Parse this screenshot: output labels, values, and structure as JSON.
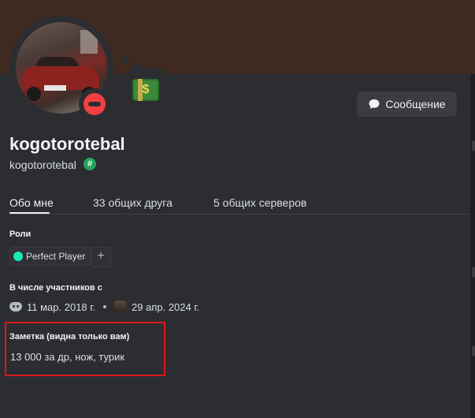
{
  "profile": {
    "display_name": "kogotorotebal",
    "username": "kogotorotebal",
    "badge_glyph": "#",
    "status": "do-not-disturb",
    "custom_status_emoji": "dollar-banknote-icon"
  },
  "actions": {
    "message_label": "Сообщение"
  },
  "tabs": [
    {
      "label": "Обо мне",
      "active": true
    },
    {
      "label": "33 общих друга",
      "active": false
    },
    {
      "label": "5 общих серверов",
      "active": false
    }
  ],
  "roles": {
    "title": "Роли",
    "items": [
      {
        "label": "Perfect Player",
        "color": "#1de9b6"
      }
    ],
    "add_glyph": "+"
  },
  "member_since": {
    "title": "В числе участников с",
    "discord_date": "11 мар. 2018 г.",
    "server_date": "29 апр. 2024 г."
  },
  "note": {
    "title": "Заметка (видна только вам)",
    "text": "13 000 за др, нож, турик"
  },
  "colors": {
    "banner": "#3f2a22",
    "dnd": "#f23f43",
    "highlight_box": "#e0161e"
  }
}
